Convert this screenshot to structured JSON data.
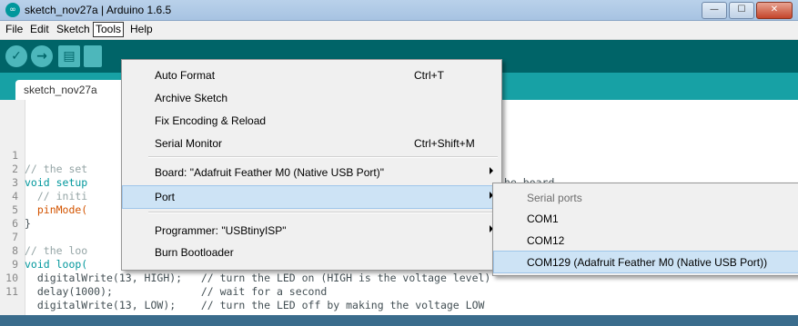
{
  "window": {
    "title": "sketch_nov27a | Arduino 1.6.5",
    "app_icon": "∞",
    "controls": {
      "minimize": "—",
      "maximize": "☐",
      "close": "✕"
    }
  },
  "menubar": {
    "items": [
      "File",
      "Edit",
      "Sketch",
      "Tools",
      "Help"
    ],
    "open_menu": "Tools"
  },
  "toolbar": {
    "icons": [
      "verify-icon",
      "upload-icon",
      "new-icon",
      "open-icon"
    ],
    "glyphs": {
      "verify": "✓",
      "upload": "→",
      "new": "▤"
    }
  },
  "tabs": [
    {
      "label": "sketch_nov27a"
    }
  ],
  "editor": {
    "line_numbers": [
      "1",
      "2",
      "3",
      "4",
      "5",
      "6",
      "7",
      "8",
      "9",
      "10",
      "11"
    ],
    "lines": [
      {
        "text": "// the set",
        "right": "he board"
      },
      {
        "text": "void setup"
      },
      {
        "text": "  // initi"
      },
      {
        "text": "  pinMode("
      },
      {
        "text": "}"
      },
      {
        "text": ""
      },
      {
        "text": "// the loo"
      },
      {
        "text": "void loop("
      },
      {
        "text": "  digitalWrite(13, HIGH);   // turn the LED on (HIGH is the voltage level)"
      },
      {
        "text": "  delay(1000);              // wait for a second"
      },
      {
        "text": "  digitalWrite(13, LOW);    // turn the LED off by making the voltage LOW"
      }
    ]
  },
  "tools_menu": {
    "items": [
      {
        "label": "Auto Format",
        "shortcut": "Ctrl+T"
      },
      {
        "label": "Archive Sketch",
        "shortcut": ""
      },
      {
        "label": "Fix Encoding & Reload",
        "shortcut": ""
      },
      {
        "label": "Serial Monitor",
        "shortcut": "Ctrl+Shift+M"
      },
      {
        "label": "Board: \"Adafruit Feather M0 (Native USB Port)\"",
        "submenu": true
      },
      {
        "label": "Port",
        "submenu": true,
        "highlighted": true
      },
      {
        "label": "Programmer: \"USBtinyISP\"",
        "submenu": true
      },
      {
        "label": "Burn Bootloader",
        "shortcut": ""
      }
    ]
  },
  "port_submenu": {
    "header": "Serial ports",
    "items": [
      {
        "label": "COM1"
      },
      {
        "label": "COM12"
      },
      {
        "label": "COM129 (Adafruit Feather M0 (Native USB Port))",
        "highlighted": true
      }
    ]
  },
  "colors": {
    "toolbar": "#006468",
    "tabstrip": "#17a1a5",
    "keyword": "#00979c",
    "function": "#d35400",
    "comment": "#95a5a6",
    "highlight": "#cde3f5"
  }
}
